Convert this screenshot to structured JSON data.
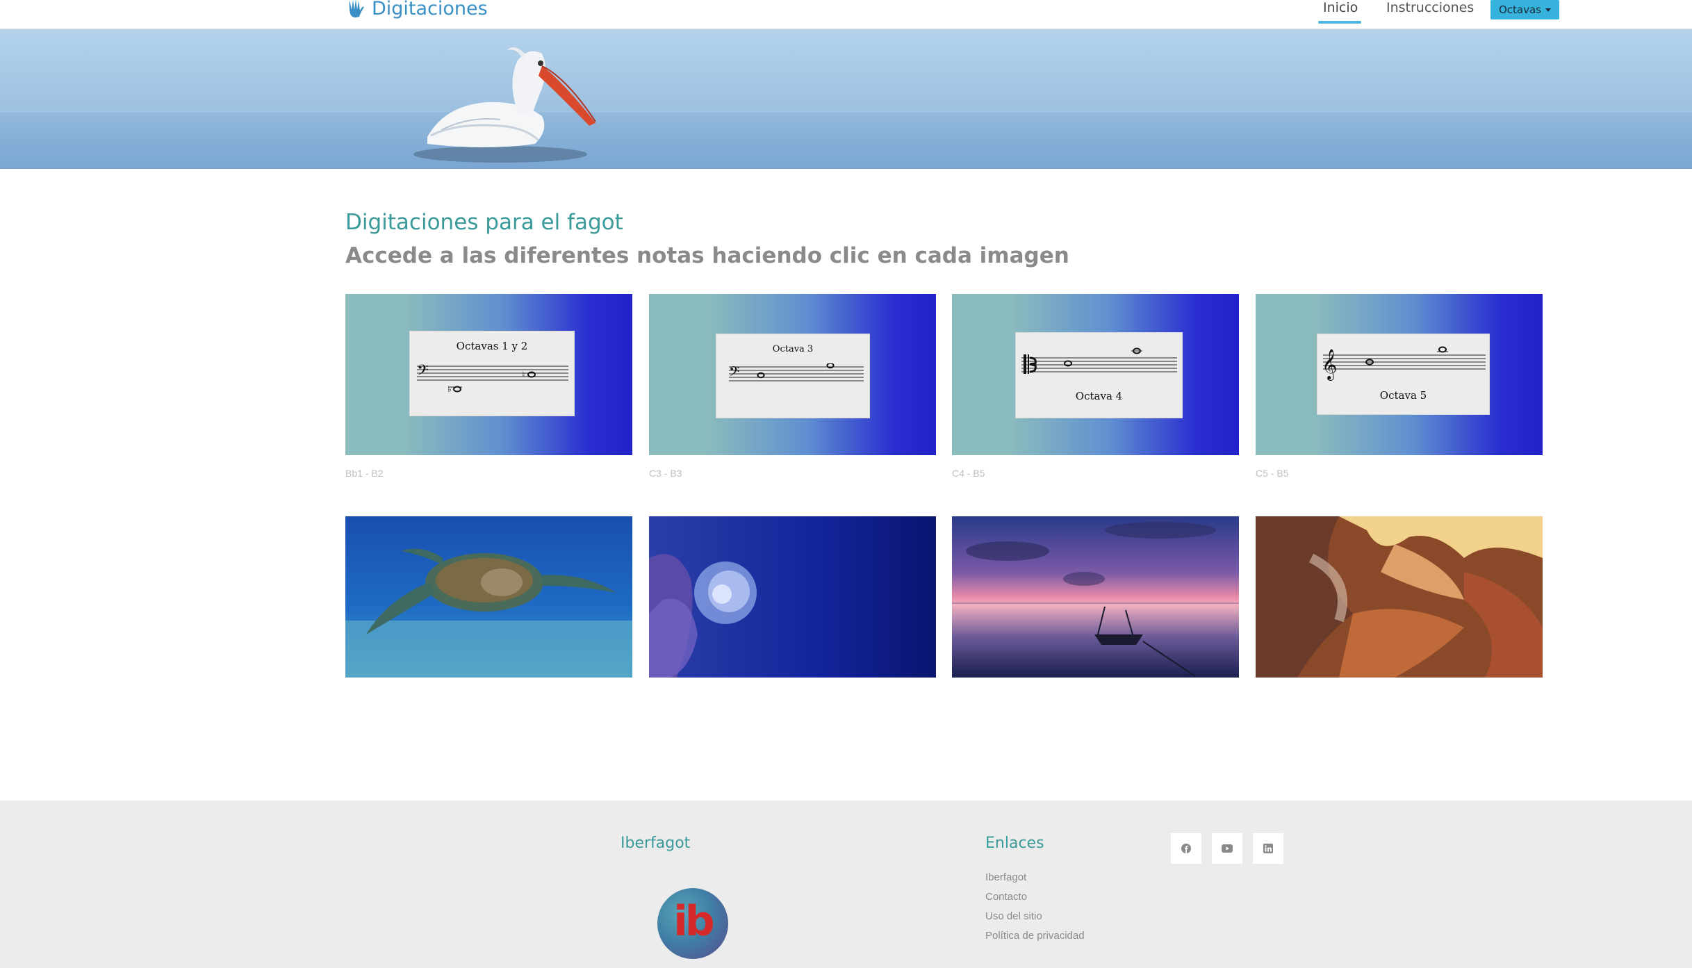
{
  "nav": {
    "brand": "Digitaciones",
    "links": [
      "Inicio",
      "Instrucciones"
    ],
    "dropdown_label": "Octavas",
    "accent_color": "#36b2dc"
  },
  "main": {
    "title": "Digitaciones para el fagot",
    "subtitle": "Accede a las diferentes notas haciendo clic en cada imagen"
  },
  "octave_cards": [
    {
      "sheet_title": "Octavas 1 y 2",
      "caption": "Bb1 - B2",
      "clef": "bass-clef-icon"
    },
    {
      "sheet_title": "Octava 3",
      "caption": "C3 - B3",
      "clef": "bass-clef-icon"
    },
    {
      "sheet_title": "Octava 4",
      "caption": "C4 - B5",
      "clef": "tenor-clef-icon"
    },
    {
      "sheet_title": "Octava 5",
      "caption": "C5 - B5",
      "clef": "treble-clef-icon"
    }
  ],
  "photo_cards": [
    {
      "name": "sea-turtle-photo"
    },
    {
      "name": "anemone-photo"
    },
    {
      "name": "sunset-boat-photo"
    },
    {
      "name": "canyon-photo"
    }
  ],
  "footer": {
    "brand_title": "Iberfagot",
    "logo_text": "ib",
    "links_title": "Enlaces",
    "links": [
      "Iberfagot",
      "Contacto",
      "Uso del sitio",
      "Política de privacidad"
    ],
    "social_icons": [
      "facebook-icon",
      "youtube-icon",
      "linkedin-icon"
    ]
  }
}
